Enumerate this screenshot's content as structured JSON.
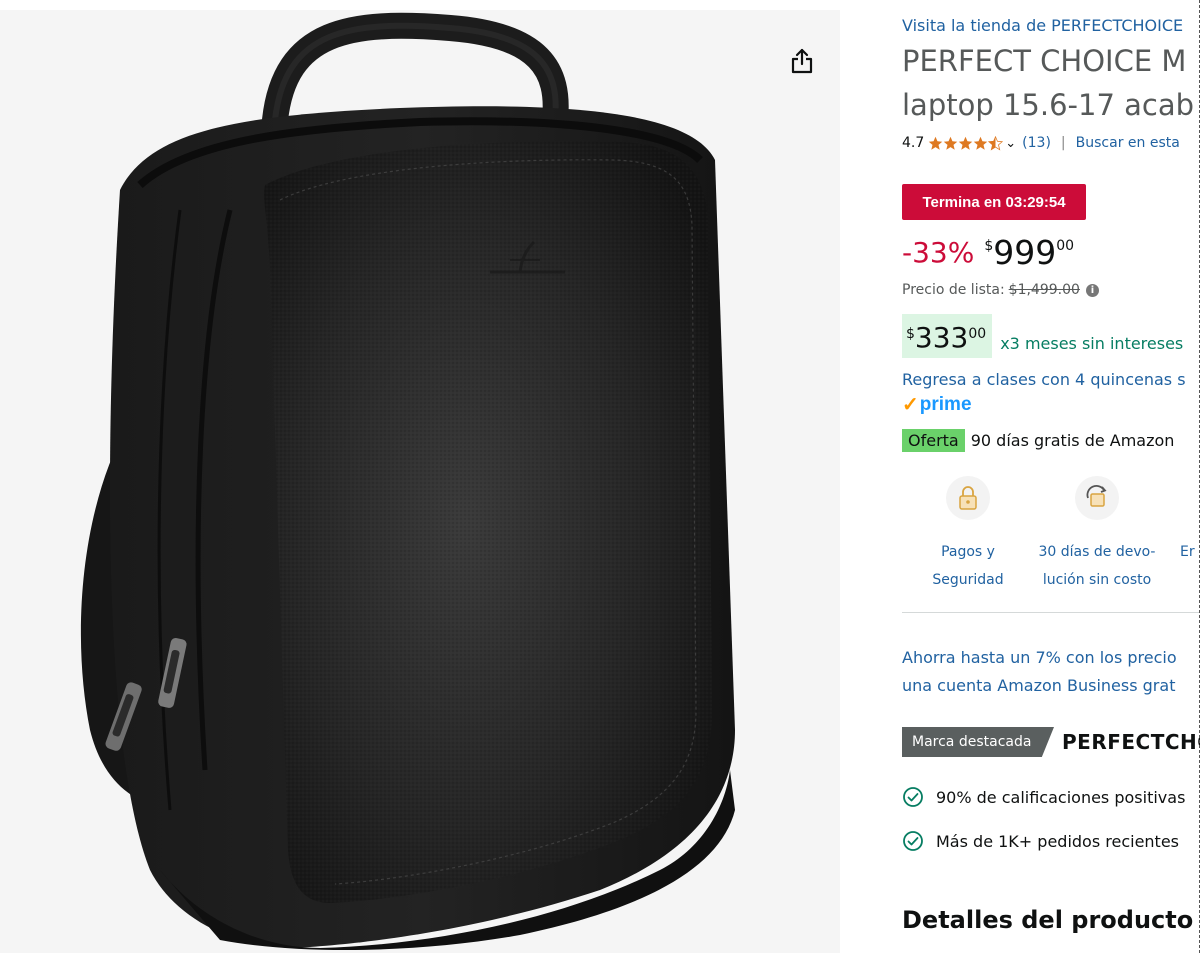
{
  "share_icon": "share-icon",
  "product": {
    "store_link": "Visita la tienda de PERFECTCHOICE",
    "title_line1": "PERFECT CHOICE M",
    "title_line2": "laptop 15.6-17 acab",
    "rating": "4.7",
    "rating_stars": 4.5,
    "review_count": "(13)",
    "search_link": "Buscar en esta"
  },
  "deal": {
    "badge": "Termina en 03:29:54",
    "discount": "-33%",
    "currency": "$",
    "price_whole": "999",
    "price_cents": "00",
    "list_price_label": "Precio de lista:",
    "list_price": "$1,499.00",
    "info_icon": "i"
  },
  "installments": {
    "currency": "$",
    "whole": "333",
    "cents": "00",
    "text": "x3 meses sin intereses"
  },
  "promo_link": "Regresa a clases con 4 quincenas s",
  "prime": {
    "check": "✓",
    "label": "prime"
  },
  "offer": {
    "badge": "Oferta",
    "text": "90 días gratis de Amazon"
  },
  "features": [
    {
      "line1": "Pagos y",
      "line2": "Seguridad",
      "icon": "lock-icon"
    },
    {
      "line1": "30 días de devo-",
      "line2": "lución sin costo",
      "icon": "return-icon"
    },
    {
      "line1": "Er",
      "line2": "",
      "icon": ""
    }
  ],
  "business": {
    "line1": "Ahorra hasta un 7% con los precio",
    "line2": "una cuenta Amazon Business grat"
  },
  "brand": {
    "badge": "Marca destacada",
    "name": "PERFECTCHO"
  },
  "highlights": [
    "90% de calificaciones positivas",
    "Más de 1K+ pedidos recientes"
  ],
  "section_heading": "Detalles del producto",
  "colors": {
    "link": "#2162a1",
    "deal_red": "#cc0c39",
    "installment_green": "#067d62",
    "prime_blue": "#1a98ff",
    "offer_green": "#6ad16a"
  }
}
